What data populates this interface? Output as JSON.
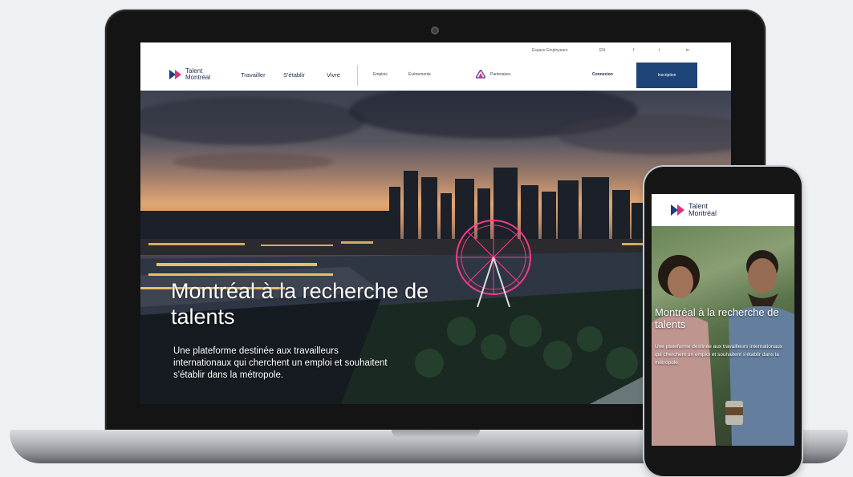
{
  "laptop": {
    "topbar": {
      "links": [
        "Espace Employeurs",
        "EN"
      ],
      "social_icons": [
        "facebook-icon",
        "twitter-icon",
        "linkedin-icon"
      ],
      "social_labels": [
        "f",
        "t",
        "in"
      ]
    },
    "logo": {
      "line1": "Talent",
      "line2": "Montréal"
    },
    "nav": {
      "main": [
        "Travailler",
        "S'établir",
        "Vivre"
      ],
      "secondary": [
        "Emplois",
        "Événements"
      ],
      "partner_label": "Partenaires",
      "login": "Connexion",
      "cta": "Inscription"
    },
    "hero": {
      "title": "Montréal à la recherche de talents",
      "subtitle": "Une plateforme destinée aux travailleurs internationaux qui cherchent un emploi et souhaitent s'établir dans la métropole."
    }
  },
  "phone": {
    "logo": {
      "line1": "Talent",
      "line2": "Montréal"
    },
    "hero": {
      "title": "Montréal à la recherche de talents",
      "subtitle": "Une plateforme destinée aux travailleurs internationaux qui cherchent un emploi et souhaitent s'établir dans la métropole."
    }
  },
  "colors": {
    "brand_navy": "#1e4577",
    "brand_pink": "#d9327a",
    "logo_blue": "#1f3d7a"
  }
}
